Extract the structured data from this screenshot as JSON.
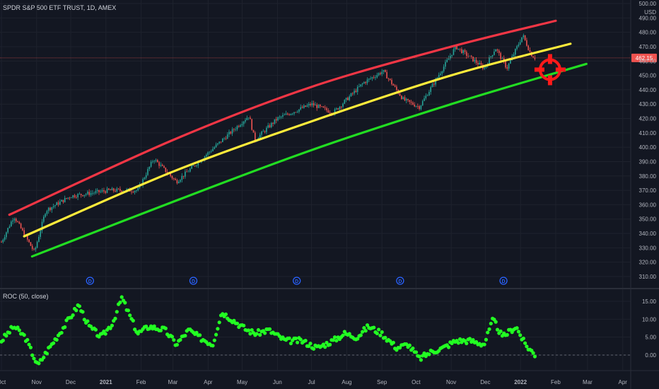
{
  "chart_data": [
    {
      "type": "candlestick",
      "title": "SPDR S&P 500 ETF TRUST, 1D, AMEX",
      "ylabel": "USD",
      "ylim": [
        303,
        500
      ],
      "y_ticks": [
        310,
        320,
        330,
        340,
        350,
        360,
        370,
        380,
        390,
        400,
        410,
        420,
        430,
        440,
        450,
        460,
        470,
        480,
        490,
        500
      ],
      "price_label": "462.15",
      "colors": {
        "up": "#26a69a",
        "down": "#ef5350",
        "price_line": "#ef5350"
      },
      "price_path": [
        [
          "2020-10-01",
          334
        ],
        [
          "2020-10-12",
          352
        ],
        [
          "2020-10-30",
          327
        ],
        [
          "2020-11-09",
          356
        ],
        [
          "2020-12-01",
          366
        ],
        [
          "2021-01-04",
          370
        ],
        [
          "2021-01-29",
          370
        ],
        [
          "2021-02-12",
          392
        ],
        [
          "2021-03-04",
          376
        ],
        [
          "2021-04-01",
          396
        ],
        [
          "2021-05-07",
          422
        ],
        [
          "2021-05-12",
          405
        ],
        [
          "2021-06-01",
          420
        ],
        [
          "2021-07-01",
          430
        ],
        [
          "2021-07-20",
          424
        ],
        [
          "2021-08-16",
          445
        ],
        [
          "2021-09-02",
          453
        ],
        [
          "2021-09-20",
          433
        ],
        [
          "2021-10-04",
          428
        ],
        [
          "2021-11-05",
          470
        ],
        [
          "2021-11-30",
          455
        ],
        [
          "2021-12-10",
          469
        ],
        [
          "2021-12-20",
          455
        ],
        [
          "2022-01-03",
          478
        ],
        [
          "2022-01-10",
          465
        ],
        [
          "2022-01-14",
          462
        ]
      ],
      "channels": [
        {
          "color": "#f23645",
          "points": [
            [
              "2020-10-08",
              353
            ],
            [
              "2021-03-01",
              405
            ],
            [
              "2021-07-01",
              442
            ],
            [
              "2021-11-01",
              470
            ],
            [
              "2022-02-01",
              488
            ]
          ]
        },
        {
          "color": "#ffeb3b",
          "points": [
            [
              "2020-10-21",
              338
            ],
            [
              "2021-03-01",
              383
            ],
            [
              "2021-07-01",
              418
            ],
            [
              "2021-11-01",
              450
            ],
            [
              "2022-02-14",
              472
            ]
          ]
        },
        {
          "color": "#22dd22",
          "points": [
            [
              "2020-10-28",
              324
            ],
            [
              "2021-03-01",
              362
            ],
            [
              "2021-07-01",
              398
            ],
            [
              "2021-11-01",
              430
            ],
            [
              "2022-02-28",
              458
            ]
          ]
        }
      ],
      "target_marker": {
        "date": "2022-01-27",
        "value": 454,
        "color": "#ff1a1a"
      },
      "dividend_label": "D",
      "dividend_dates": [
        "2020-12-18",
        "2021-03-19",
        "2021-06-18",
        "2021-09-17",
        "2021-12-17"
      ]
    },
    {
      "type": "scatter",
      "title": "ROC (50, close)",
      "ylim": [
        -5.5,
        18
      ],
      "y_ticks": [
        "0.00",
        "5.00",
        "10.00",
        "15.00"
      ],
      "zero_line": true,
      "color": "#22ff22",
      "points": [
        [
          "2020-10-01",
          4
        ],
        [
          "2020-10-12",
          8
        ],
        [
          "2020-10-22",
          5
        ],
        [
          "2020-11-02",
          -3
        ],
        [
          "2020-11-10",
          1
        ],
        [
          "2020-11-23",
          7
        ],
        [
          "2020-12-08",
          14
        ],
        [
          "2020-12-17",
          8
        ],
        [
          "2020-12-28",
          5
        ],
        [
          "2021-01-07",
          9
        ],
        [
          "2021-01-15",
          16
        ],
        [
          "2021-01-29",
          6
        ],
        [
          "2021-02-08",
          8
        ],
        [
          "2021-02-22",
          7
        ],
        [
          "2021-03-04",
          3
        ],
        [
          "2021-03-15",
          7
        ],
        [
          "2021-03-24",
          5
        ],
        [
          "2021-04-05",
          3
        ],
        [
          "2021-04-13",
          12
        ],
        [
          "2021-05-05",
          7
        ],
        [
          "2021-05-13",
          6
        ],
        [
          "2021-05-24",
          7
        ],
        [
          "2021-06-08",
          4
        ],
        [
          "2021-06-22",
          4
        ],
        [
          "2021-07-06",
          2
        ],
        [
          "2021-07-20",
          4
        ],
        [
          "2021-07-30",
          6
        ],
        [
          "2021-08-10",
          5
        ],
        [
          "2021-08-20",
          8
        ],
        [
          "2021-09-01",
          6
        ],
        [
          "2021-09-14",
          2
        ],
        [
          "2021-09-24",
          3
        ],
        [
          "2021-10-04",
          -1
        ],
        [
          "2021-10-15",
          1
        ],
        [
          "2021-10-25",
          2
        ],
        [
          "2021-11-05",
          4
        ],
        [
          "2021-11-18",
          4
        ],
        [
          "2021-11-30",
          3
        ],
        [
          "2021-12-08",
          10
        ],
        [
          "2021-12-16",
          5
        ],
        [
          "2021-12-28",
          8
        ],
        [
          "2022-01-05",
          3
        ],
        [
          "2022-01-14",
          0
        ]
      ],
      "x_ticks": [
        "Oct",
        "Nov",
        "Dec",
        "2021",
        "Feb",
        "Mar",
        "Apr",
        "May",
        "Jun",
        "Jul",
        "Aug",
        "Sep",
        "Oct",
        "Nov",
        "Dec",
        "2022",
        "Feb",
        "Mar",
        "Apr"
      ]
    }
  ]
}
